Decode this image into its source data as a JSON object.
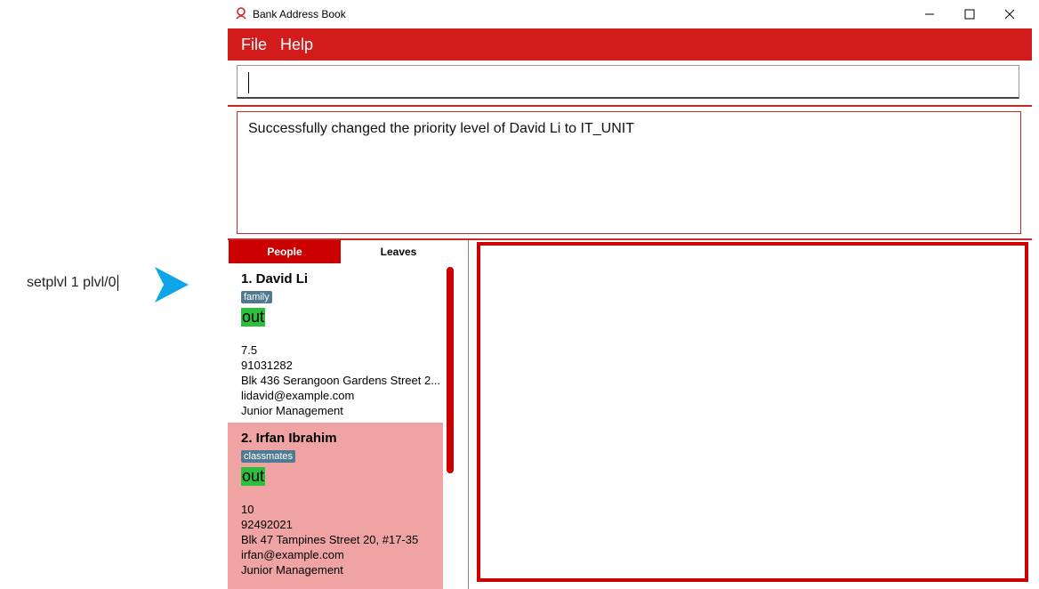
{
  "annotation": {
    "command_text": "setplvl 1 plvl/0"
  },
  "window": {
    "title": "Bank Address Book",
    "controls": {
      "minimize": "minimize-icon",
      "maximize": "maximize-icon",
      "close": "close-icon"
    }
  },
  "menu": {
    "file": "File",
    "help": "Help"
  },
  "command_box": {
    "value": ""
  },
  "result": {
    "message": "Successfully changed the priority level of David Li to IT_UNIT"
  },
  "tabs": {
    "people": "People",
    "leaves": "Leaves"
  },
  "people": [
    {
      "index_name": "1.  David Li",
      "tag": "family",
      "status": "out",
      "salary": "7.5",
      "phone": "91031282",
      "address": "Blk 436 Serangoon Gardens Street 2...",
      "email": "lidavid@example.com",
      "role": "Junior Management"
    },
    {
      "index_name": "2.  Irfan Ibrahim",
      "tag": "classmates",
      "status": "out",
      "salary": "10",
      "phone": "92492021",
      "address": "Blk 47 Tampines Street 20, #17-35",
      "email": "irfan@example.com",
      "role": "Junior Management"
    }
  ],
  "colors": {
    "accent": "#d21c1c",
    "selected_card": "#efa3a3",
    "status_out": "#2bbf3b",
    "tag": "#4f7a92"
  }
}
